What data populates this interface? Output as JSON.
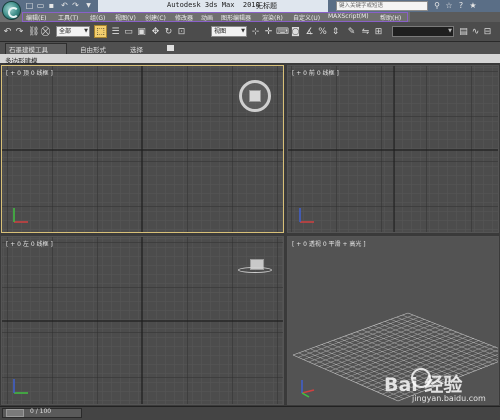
{
  "titlebar": {
    "app_title": "Autodesk 3ds Max  2010",
    "doc_title": "无标题",
    "search_placeholder": "键入关键字或短语",
    "icons": [
      "new-icon",
      "open-icon",
      "save-icon",
      "undo-icon",
      "redo-icon",
      "dropdown-icon",
      "binoculars-icon",
      "star-icon",
      "help-icon",
      "favorites-icon"
    ]
  },
  "menus": [
    "编辑(E)",
    "工具(T)",
    "组(G)",
    "视图(V)",
    "创建(C)",
    "修改器",
    "动画",
    "图形编辑器",
    "渲染(R)",
    "自定义(U)",
    "MAXScript(M)",
    "帮助(H)"
  ],
  "toolbar": {
    "selection_filter": "全部",
    "coord_system": "视图",
    "icons": [
      "select-object-icon",
      "select-by-name-icon",
      "rect-selection-icon",
      "window-crossing-icon",
      "move-icon",
      "rotate-icon",
      "scale-icon",
      "pivot-icon",
      "select-manipulate-icon",
      "keyboard-shortcut-icon",
      "snap-icon",
      "angle-snap-icon",
      "percent-snap-icon",
      "spinner-snap-icon",
      "named-selection-icon",
      "mirror-icon",
      "align-icon",
      "layer-icon",
      "curve-editor-icon",
      "schematic-icon",
      "material-editor-icon",
      "render-setup-icon",
      "render-frame-icon",
      "render-icon"
    ]
  },
  "ribbon": {
    "tabs": [
      "石墨建模工具",
      "自由形式",
      "选择"
    ],
    "panel_label": "多边形建模"
  },
  "viewports": {
    "top": "[ + 0 顶 0 线框 ]",
    "front": "[ + 0 前 0 线框 ]",
    "left": "[ + 0 左 0 线框 ]",
    "perspective": "[ + 0 透视 0 平滑 + 高光 ]"
  },
  "statusbar": {
    "frame": "0 / 100"
  },
  "watermark": {
    "logo": "Bai  经验",
    "url": "jingyan.baidu.com"
  }
}
